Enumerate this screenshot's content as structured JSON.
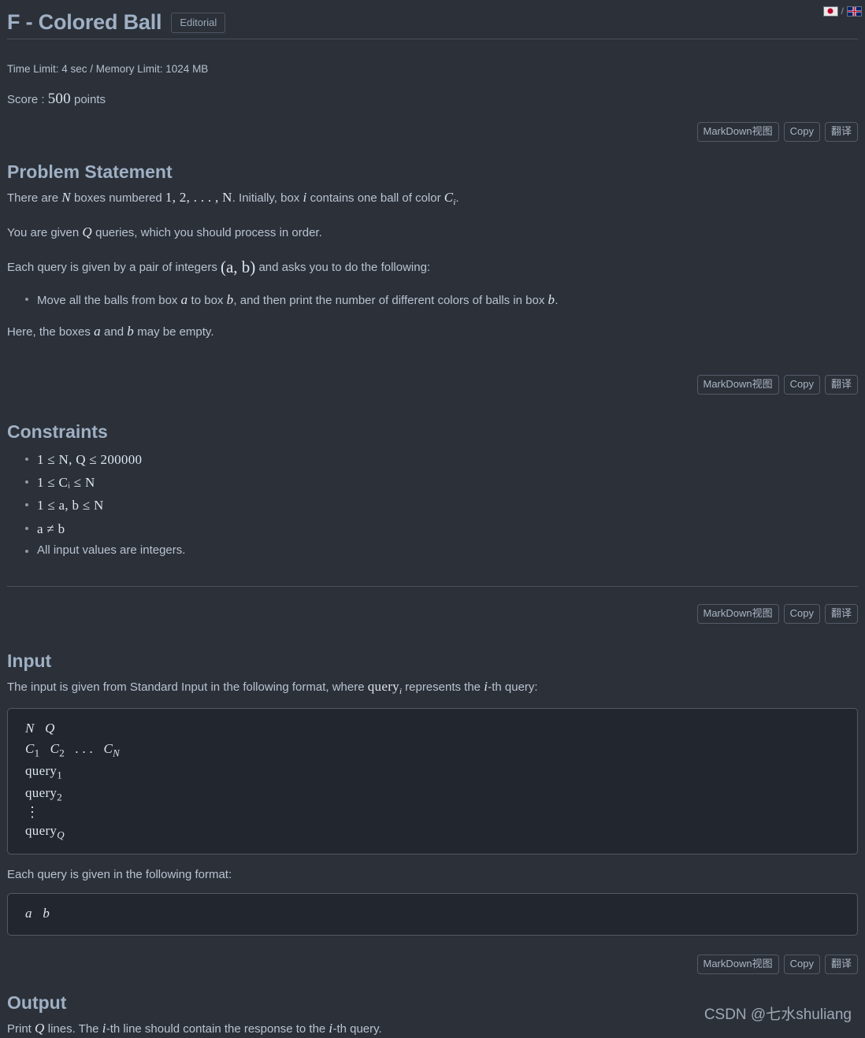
{
  "header": {
    "title": "F - Colored Ball",
    "editorial_label": "Editorial",
    "lang": {
      "jp_icon": "japan-flag-icon",
      "separator": "/",
      "uk_icon": "uk-flag-icon"
    }
  },
  "meta": {
    "limits": "Time Limit: 4 sec / Memory Limit: 1024 MB",
    "score_prefix": "Score :",
    "score_value": "500",
    "score_suffix": "points"
  },
  "toolbar": {
    "markdown_label": "MarkDown视图",
    "copy_label": "Copy",
    "translate_label": "翻译"
  },
  "problem_statement": {
    "heading": "Problem Statement",
    "p1": {
      "t1": "There are ",
      "m1": "N",
      "t2": " boxes numbered ",
      "m2": "1, 2, . . . , N",
      "t3": ". Initially, box ",
      "m3": "i",
      "t4": " contains one ball of color ",
      "m4": "C",
      "m4sub": "i",
      "t5": "."
    },
    "p2": {
      "t1": "You are given ",
      "m1": "Q",
      "t2": " queries, which you should process in order."
    },
    "p3": {
      "t1": "Each query is given by a pair of integers ",
      "m1": "(a, b)",
      "t2": " and asks you to do the following:"
    },
    "bullet1": {
      "t1": "Move all the balls from box ",
      "m1": "a",
      "t2": " to box ",
      "m2": "b",
      "t3": ", and then print the number of different colors of balls in box ",
      "m3": "b",
      "t4": "."
    },
    "p4": {
      "t1": "Here, the boxes ",
      "m1": "a",
      "t2": " and ",
      "m2": "b",
      "t3": " may be empty."
    }
  },
  "constraints": {
    "heading": "Constraints",
    "items": [
      "1 ≤ N, Q ≤ 200000",
      "1 ≤ Cᵢ ≤ N",
      "1 ≤ a, b ≤ N",
      "a ≠ b",
      "All input values are integers."
    ]
  },
  "input_section": {
    "heading": "Input",
    "description": {
      "t1": "The input is given from Standard Input in the following format, where ",
      "m1": "query",
      "m1sub": "i",
      "t2": " represents the ",
      "m2": "i",
      "t3": "-th query:"
    },
    "format_block": "N   Q\nC₁   C₂   . . .   C_N\nquery₁\nquery₂\n⋮\nquery_Q",
    "format_lines": [
      "N   Q",
      "C_1   C_2   . . .   C_N",
      "query_1",
      "query_2",
      "⋮",
      "query_Q"
    ],
    "query_format_label": "Each query is given in the following format:",
    "query_format_block": "a   b"
  },
  "output_section": {
    "heading": "Output",
    "description": {
      "t1": "Print ",
      "m1": "Q",
      "t2": " lines. The ",
      "m2": "i",
      "t3": "-th line should contain the response to the ",
      "m3": "i",
      "t4": "-th query."
    }
  },
  "watermark": {
    "text": "CSDN @七水shuliang"
  },
  "colors": {
    "background": "#2b3039",
    "heading": "#9fb0c4",
    "body_text": "#b9c3d0",
    "code_background": "#22262e",
    "border": "#525a66",
    "rule": "#4a515b"
  }
}
